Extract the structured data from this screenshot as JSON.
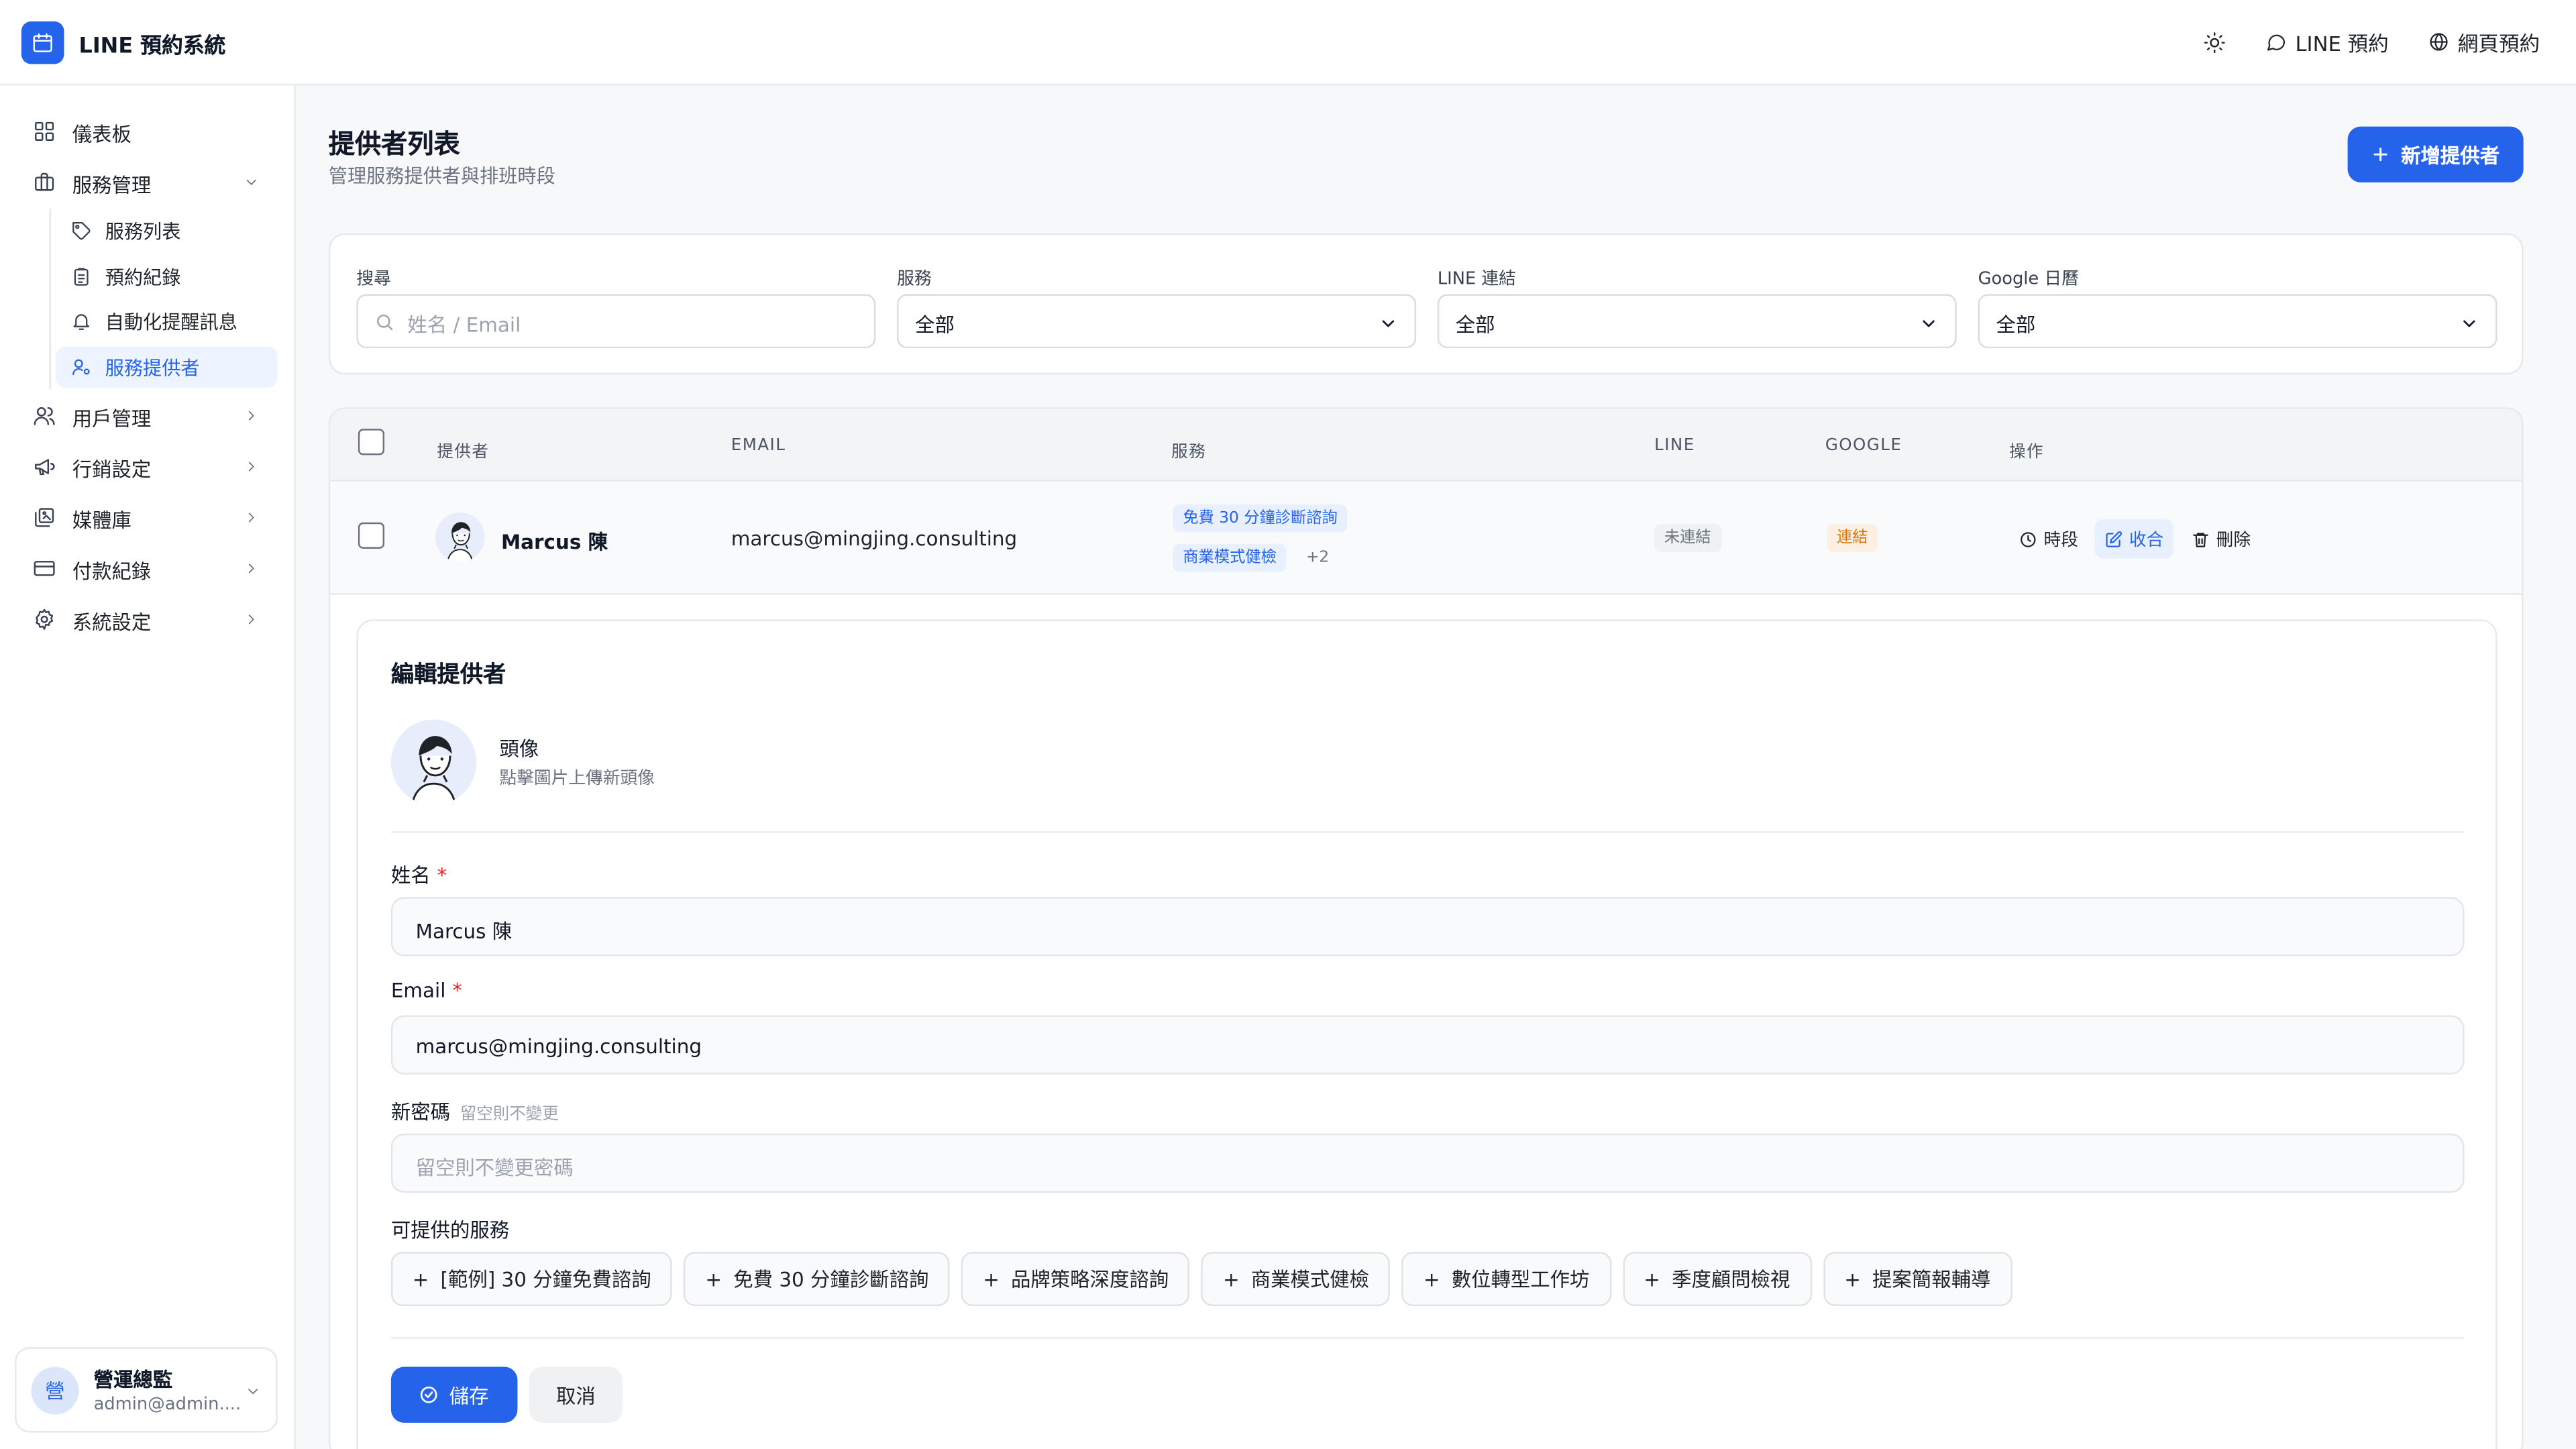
{
  "app": {
    "title": "LINE 預約系統"
  },
  "header": {
    "line_booking": "LINE 預約",
    "web_booking": "網頁預約"
  },
  "sidebar": {
    "dashboard": "儀表板",
    "service_mgmt": "服務管理",
    "sub_items": [
      "服務列表",
      "預約紀錄",
      "自動化提醒訊息",
      "服務提供者"
    ],
    "user_mgmt": "用戶管理",
    "marketing": "行銷設定",
    "media": "媒體庫",
    "payments": "付款紀錄",
    "settings": "系統設定"
  },
  "user": {
    "initial": "營",
    "name": "營運總監",
    "email": "admin@admin...."
  },
  "page": {
    "title": "提供者列表",
    "subtitle": "管理服務提供者與排班時段",
    "add_button": "新增提供者"
  },
  "filters": {
    "search_label": "搜尋",
    "search_placeholder": "姓名 / Email",
    "service_label": "服務",
    "service_value": "全部",
    "line_label": "LINE 連結",
    "line_value": "全部",
    "google_label": "Google 日曆",
    "google_value": "全部"
  },
  "table": {
    "headers": {
      "provider": "提供者",
      "email": "EMAIL",
      "services": "服務",
      "line": "LINE",
      "google": "GOOGLE",
      "actions": "操作"
    },
    "row": {
      "name": "Marcus 陳",
      "email": "marcus@mingjing.consulting",
      "service_tags": [
        "免費 30 分鐘診斷諮詢",
        "商業模式健檢"
      ],
      "more_count": "+2",
      "line_status": "未連結",
      "google_status": "連結",
      "actions": {
        "schedule": "時段",
        "collapse": "收合",
        "delete": "刪除"
      }
    }
  },
  "edit": {
    "title": "編輯提供者",
    "avatar_title": "頭像",
    "avatar_hint": "點擊圖片上傳新頭像",
    "name_label": "姓名",
    "name_value": "Marcus 陳",
    "email_label": "Email",
    "email_value": "marcus@mingjing.consulting",
    "password_label": "新密碼",
    "password_hint": "留空則不變更",
    "password_placeholder": "留空則不變更密碼",
    "services_label": "可提供的服務",
    "services": [
      "[範例] 30 分鐘免費諮詢",
      "免費 30 分鐘診斷諮詢",
      "品牌策略深度諮詢",
      "商業模式健檢",
      "數位轉型工作坊",
      "季度顧問檢視",
      "提案簡報輔導"
    ],
    "required_mark": "*",
    "save": "儲存",
    "cancel": "取消"
  },
  "colors": {
    "primary": "#2563eb",
    "active_bg": "#eef4ff",
    "orange": "#d9730d"
  }
}
